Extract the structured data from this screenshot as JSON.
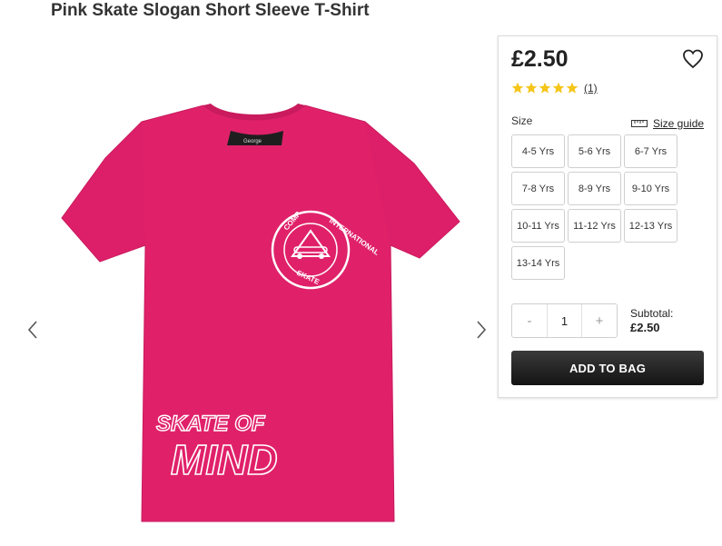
{
  "product": {
    "title": "Pink Skate Slogan Short Sleeve T-Shirt",
    "image_print": {
      "badge_lines": [
        "COMP",
        "INTERNATIONAL",
        "SKATE"
      ],
      "slogan_top": "SKATE OF",
      "slogan_bottom": "MIND",
      "neck_label": "George"
    },
    "shirt_color": "#e0216a"
  },
  "gallery": {
    "prev_icon": "chevron-left-icon",
    "next_icon": "chevron-right-icon"
  },
  "panel": {
    "price": "£2.50",
    "wishlist_icon": "heart-icon",
    "rating": {
      "stars": 5,
      "max": 5,
      "count_label": "(1)",
      "star_color": "#f5c518"
    },
    "size_label": "Size",
    "size_guide_label": "Size guide",
    "sizes": [
      "4-5 Yrs",
      "5-6 Yrs",
      "6-7 Yrs",
      "7-8 Yrs",
      "8-9 Yrs",
      "9-10 Yrs",
      "10-11 Yrs",
      "11-12 Yrs",
      "12-13 Yrs",
      "13-14 Yrs"
    ],
    "quantity": {
      "minus": "-",
      "value": "1",
      "plus": "+"
    },
    "subtotal_label": "Subtotal:",
    "subtotal_value": "£2.50",
    "add_to_bag": "ADD TO BAG"
  }
}
